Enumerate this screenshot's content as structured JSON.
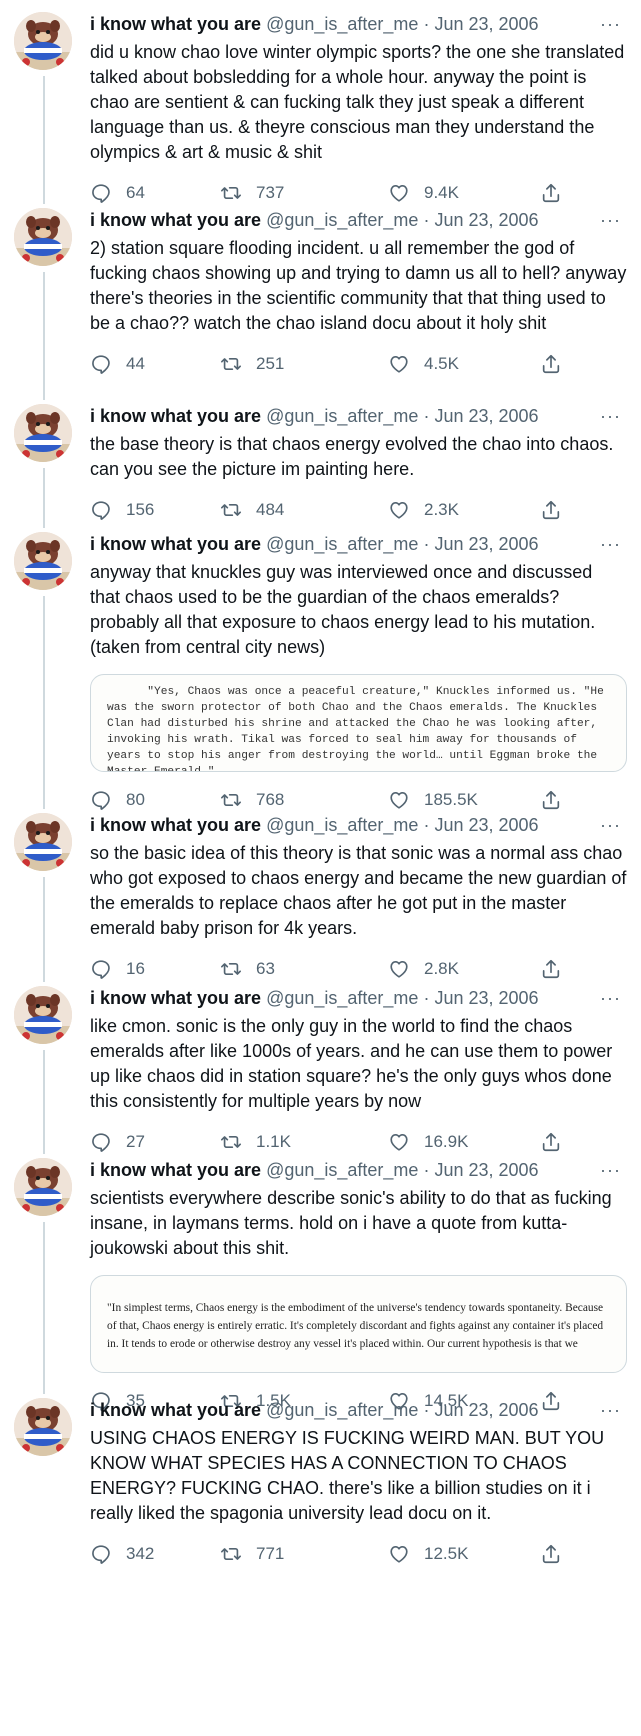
{
  "user": {
    "display_name": "i know what you are",
    "handle": "@gun_is_after_me",
    "separator": "·",
    "more": "···"
  },
  "icons": {
    "reply": "reply-icon",
    "retweet": "retweet-icon",
    "like": "heart-icon",
    "share": "share-icon",
    "avatar": "avatar"
  },
  "colors": {
    "secondary_text": "#536471",
    "thread_line": "#cfd9de",
    "border": "#cfd9de"
  },
  "tweets": [
    {
      "date": "Jun 23, 2006",
      "text": "did u know chao love winter olympic sports? the one she translated talked about bobsledding for a whole hour. anyway the point is chao are sentient & can fucking talk they just speak a different language than us. & theyre conscious man they understand the olympics & art & music & shit",
      "replies": "64",
      "retweets": "737",
      "likes": "9.4K"
    },
    {
      "date": "Jun 23, 2006",
      "text": "2) station square flooding incident. u all remember the god of fucking chaos showing up and trying to damn us all to hell? anyway there's theories in the scientific community that that thing used to be a chao?? watch the chao island docu about it holy shit",
      "replies": "44",
      "retweets": "251",
      "likes": "4.5K"
    },
    {
      "date": "Jun 23, 2006",
      "text": "the base theory is that chaos energy evolved the chao into chaos. can you see the picture im painting here.",
      "replies": "156",
      "retweets": "484",
      "likes": "2.3K"
    },
    {
      "date": "Jun 23, 2006",
      "text": "anyway that knuckles guy was interviewed once and discussed that chaos used to be the guardian of the chaos emeralds? probably all that exposure to chaos energy lead to his mutation. (taken from central city news)",
      "media_text": "      \"Yes, Chaos was once a peaceful creature,\" Knuckles informed us. \"He was the sworn protector of both Chao and the Chaos emeralds. The Knuckles Clan had disturbed his shrine and attacked the Chao he was looking after, invoking his wrath. Tikal was forced to seal him away for thousands of years to stop his anger from destroying the world… until Eggman broke the Master Emerald…\"",
      "replies": "80",
      "retweets": "768",
      "likes": "185.5K"
    },
    {
      "date": "Jun 23, 2006",
      "text": "so the basic idea of this theory is that sonic was a normal ass chao who got exposed to chaos energy and became the new guardian of the emeralds to replace chaos after he got put in the master emerald baby prison for 4k years.",
      "replies": "16",
      "retweets": "63",
      "likes": "2.8K"
    },
    {
      "date": "Jun 23, 2006",
      "text": "like cmon. sonic is the only guy in the world to find the chaos emeralds after like 1000s of years. and he can use them to power up like chaos did in station square? he's the only guys whos done this consistently for multiple years by now",
      "replies": "27",
      "retweets": "1.1K",
      "likes": "16.9K"
    },
    {
      "date": "Jun 23, 2006",
      "text": "scientists everywhere describe sonic's ability to do that as fucking insane, in laymans terms. hold on i have a quote from kutta-joukowski about this shit.",
      "media_text": "        \"In simplest terms, Chaos energy is the embodiment of the universe's tendency towards spontaneity. Because of that, Chaos energy is entirely erratic. It's completely discordant and fights against any container it's placed in. It tends to erode or otherwise destroy any vessel it's placed within. Our current hypothesis is that we",
      "replies": "35",
      "retweets": "1.5K",
      "likes": "14.5K"
    },
    {
      "date": "Jun 23, 2006",
      "text": "USING CHAOS ENERGY IS FUCKING WEIRD MAN. BUT YOU KNOW WHAT SPECIES HAS A CONNECTION TO CHAOS ENERGY? FUCKING CHAO. there's like a billion studies on it i really liked the spagonia university lead docu on it.",
      "replies": "342",
      "retweets": "771",
      "likes": "12.5K"
    }
  ]
}
